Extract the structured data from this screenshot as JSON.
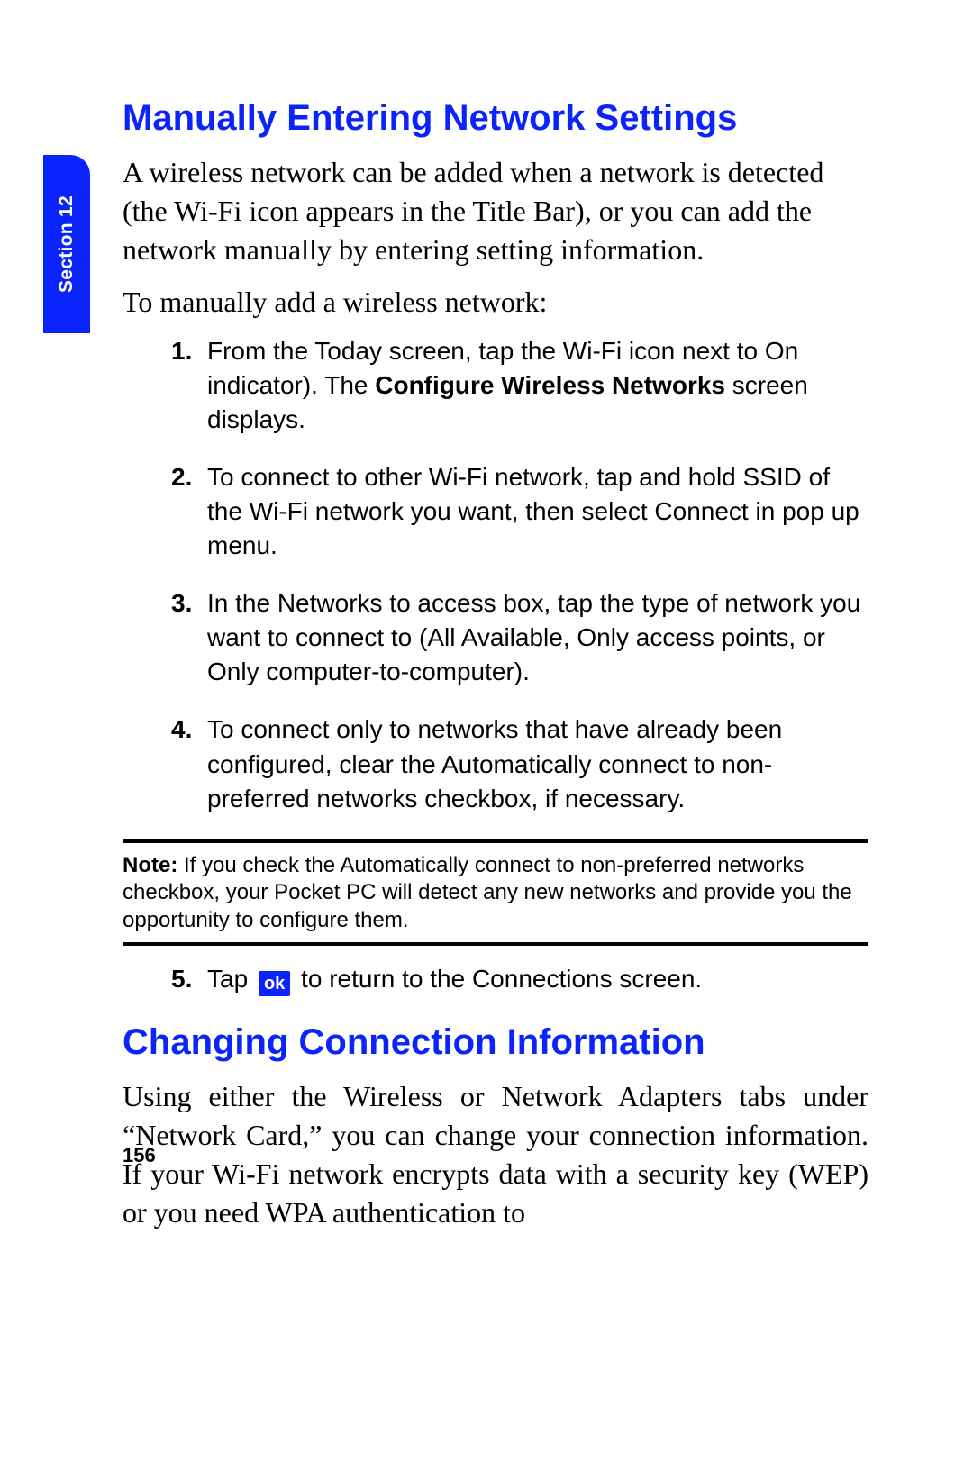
{
  "section_tab": "Section 12",
  "heading1": "Manually Entering Network Settings",
  "para1": "A wireless network can be added when a network is detected (the Wi-Fi icon appears in the Title Bar), or you can add the network manually by entering setting information.",
  "para2": "To manually add a wireless network:",
  "steps": {
    "s1_pre": "From the Today screen, tap the Wi-Fi icon next to On indicator). The ",
    "s1_bold": "Configure Wireless Networks",
    "s1_post": " screen displays.",
    "s2": "To connect to other Wi-Fi network, tap and hold SSID of the Wi-Fi network you want, then select Connect in pop up menu.",
    "s3": "In the Networks to access box, tap the type of network you want to connect to (All Available, Only access points, or Only computer-to-computer).",
    "s4": "To connect only to networks that have already been configured, clear the Automatically connect to non-preferred networks checkbox, if necessary.",
    "s5_pre": "Tap ",
    "s5_icon_label": "ok",
    "s5_post": " to return to the Connections screen."
  },
  "note": {
    "label": "Note:",
    "text": " If you check the Automatically connect to non-preferred networks checkbox, your Pocket PC will detect any new networks and provide you the opportunity to configure them."
  },
  "heading2": "Changing Connection Information",
  "para3": "Using either the Wireless or Network Adapters tabs under “Network Card,” you can change your connection information. If your Wi-Fi network encrypts data with a security key (WEP) or you need WPA authentication to",
  "page_number": "156"
}
